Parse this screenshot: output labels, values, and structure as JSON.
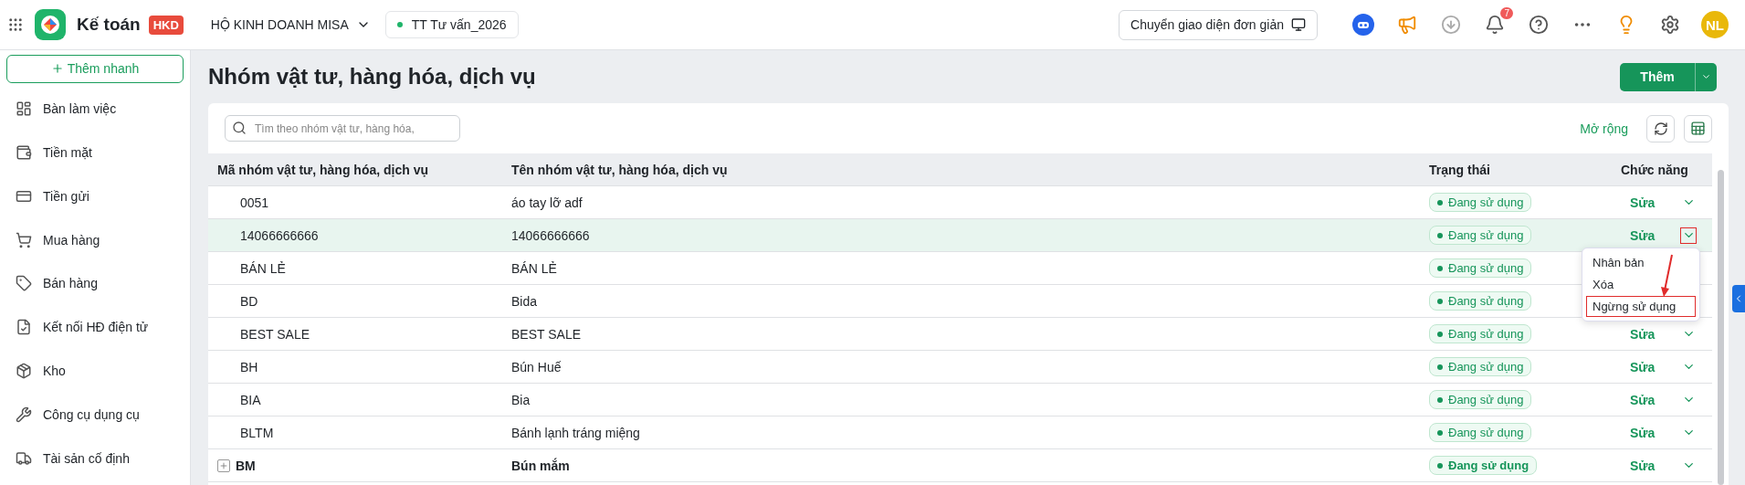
{
  "header": {
    "app_name": "Kế toán",
    "app_badge": "HKD",
    "company": "HỘ KINH DOANH MISA",
    "dataset": "TT Tư vấn_2026",
    "switch_button": "Chuyển giao diện đơn giản",
    "notifications_count": "7",
    "avatar_initials": "NL"
  },
  "sidebar": {
    "quick_add": "Thêm nhanh",
    "items": [
      {
        "label": "Bàn làm việc"
      },
      {
        "label": "Tiền mặt"
      },
      {
        "label": "Tiền gửi"
      },
      {
        "label": "Mua hàng"
      },
      {
        "label": "Bán hàng"
      },
      {
        "label": "Kết nối HĐ điện tử"
      },
      {
        "label": "Kho"
      },
      {
        "label": "Công cụ dụng cụ"
      },
      {
        "label": "Tài sản cố định"
      }
    ]
  },
  "page": {
    "title": "Nhóm vật tư, hàng hóa, dịch vụ",
    "add_button": "Thêm"
  },
  "toolbar": {
    "search": {
      "placeholder": "Tìm theo nhóm vật tư, hàng hóa,"
    },
    "expand_link": "Mở rộng"
  },
  "table": {
    "columns": [
      "Mã nhóm vật tư, hàng hóa, dịch vụ",
      "Tên nhóm vật tư, hàng hóa, dịch vụ",
      "Trạng thái",
      "Chức năng"
    ],
    "rows": [
      {
        "kind": "item",
        "code": "0051",
        "name": "áo tay lỡ adf",
        "status": "Đang sử dụng",
        "action": "Sửa",
        "chevron_annotated": false,
        "selected": false
      },
      {
        "kind": "item",
        "code": "14066666666",
        "name": "14066666666",
        "status": "Đang sử dụng",
        "action": "Sửa",
        "selected": true,
        "chevron_annotated": true,
        "menu": [
          {
            "label": "Nhân bản",
            "annotated": false
          },
          {
            "label": "Xóa",
            "annotated": false
          },
          {
            "label": "Ngừng sử dụng",
            "annotated": true
          }
        ]
      },
      {
        "kind": "item",
        "code": "BÁN LẺ",
        "name": "BÁN LẺ",
        "status": "Đang sử dụng",
        "selected": false
      },
      {
        "kind": "item",
        "code": "BD",
        "name": "Bida",
        "status": "Đang sử dụng",
        "selected": false
      },
      {
        "kind": "item",
        "code": "BEST SALE",
        "name": "BEST SALE",
        "status": "Đang sử dụng",
        "action": "Sửa",
        "chevron_annotated": false,
        "selected": false
      },
      {
        "kind": "item",
        "code": "BH",
        "name": "Bún Huế",
        "status": "Đang sử dụng",
        "action": "Sửa",
        "chevron_annotated": false,
        "selected": false
      },
      {
        "kind": "item",
        "code": "BIA",
        "name": "Bia",
        "status": "Đang sử dụng",
        "action": "Sửa",
        "chevron_annotated": false,
        "selected": false
      },
      {
        "kind": "item",
        "code": "BLTM",
        "name": "Bánh lạnh tráng miệng",
        "status": "Đang sử dụng",
        "action": "Sửa",
        "chevron_annotated": false,
        "selected": false
      },
      {
        "kind": "group",
        "code": "BM",
        "name": "Bún mắm",
        "status": "Đang sử dụng",
        "action": "Sửa",
        "chevron_annotated": false,
        "selected": false,
        "expanded": false
      }
    ]
  }
}
